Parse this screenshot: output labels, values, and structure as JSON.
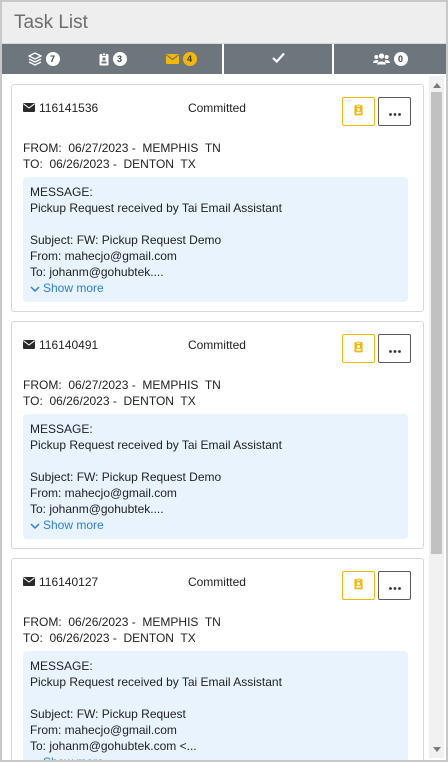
{
  "header": {
    "title": "Task List"
  },
  "tabs": {
    "group": [
      {
        "icon": "layers-icon",
        "count": "7",
        "badge_color": "#ffffff"
      },
      {
        "icon": "id-badge-icon",
        "count": "3",
        "badge_color": "#ffffff"
      },
      {
        "icon": "envelope-icon",
        "count": "4",
        "badge_color": "#f5b800"
      }
    ],
    "done_icon": "check-icon",
    "team": {
      "icon": "users-icon",
      "count": "0"
    }
  },
  "colors": {
    "tabbar": "#6d757d",
    "accent": "#f5b800",
    "message_bg": "#e8f3fd",
    "link": "#2c7fd3"
  },
  "tasks": [
    {
      "id": "116141536",
      "status": "Committed",
      "from_label": "FROM:",
      "from": "06/27/2023 -  MEMPHIS  TN",
      "to_label": "TO:",
      "to": "06/26/2023 -  DENTON  TX",
      "message_label": "MESSAGE:",
      "message_line": "Pickup Request received by Tai Email Assistant",
      "subject": "Subject: FW: Pickup Request Demo",
      "from_email": "From: mahecjo@gmail.com",
      "to_email": "To: johanm@gohubtek....",
      "show_more": "Show more"
    },
    {
      "id": "116140491",
      "status": "Committed",
      "from_label": "FROM:",
      "from": "06/27/2023 -  MEMPHIS  TN",
      "to_label": "TO:",
      "to": "06/26/2023 -  DENTON  TX",
      "message_label": "MESSAGE:",
      "message_line": "Pickup Request received by Tai Email Assistant",
      "subject": "Subject: FW: Pickup Request Demo",
      "from_email": "From: mahecjo@gmail.com",
      "to_email": "To: johanm@gohubtek....",
      "show_more": "Show more"
    },
    {
      "id": "116140127",
      "status": "Committed",
      "from_label": "FROM:",
      "from": "06/26/2023 -  MEMPHIS  TN",
      "to_label": "TO:",
      "to": "06/26/2023 -  DENTON  TX",
      "message_label": "MESSAGE:",
      "message_line": "Pickup Request received by Tai Email Assistant",
      "subject": "Subject: FW: Pickup Request",
      "from_email": "From: mahecjo@gmail.com",
      "to_email": "To: johanm@gohubtek.com <...",
      "show_more": "Show more"
    }
  ]
}
